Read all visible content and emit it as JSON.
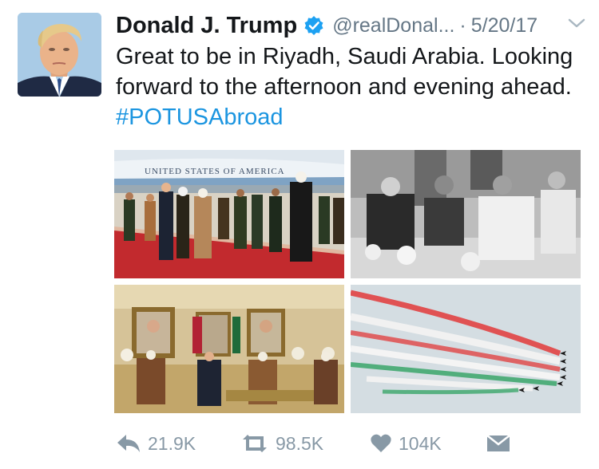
{
  "tweet": {
    "author_name": "Donald J. Trump",
    "handle": "@realDonal...",
    "separator": "·",
    "date": "5/20/17",
    "text_main": "Great to be in Riyadh, Saudi Arabia. Looking forward to the afternoon and evening ahead. ",
    "hashtag": "#POTUSAbroad",
    "photo1_caption_text": "UNITED STATES OF AMERICA"
  },
  "actions": {
    "reply_count": "21.9K",
    "retweet_count": "98.5K",
    "like_count": "104K"
  },
  "icons": {
    "verified": "verified-badge-icon",
    "caret": "chevron-down-icon",
    "reply": "reply-icon",
    "retweet": "retweet-icon",
    "like": "heart-icon",
    "dm": "envelope-icon"
  },
  "colors": {
    "link": "#1b95e0",
    "muted": "#8899a6",
    "verified": "#1da1f2"
  }
}
